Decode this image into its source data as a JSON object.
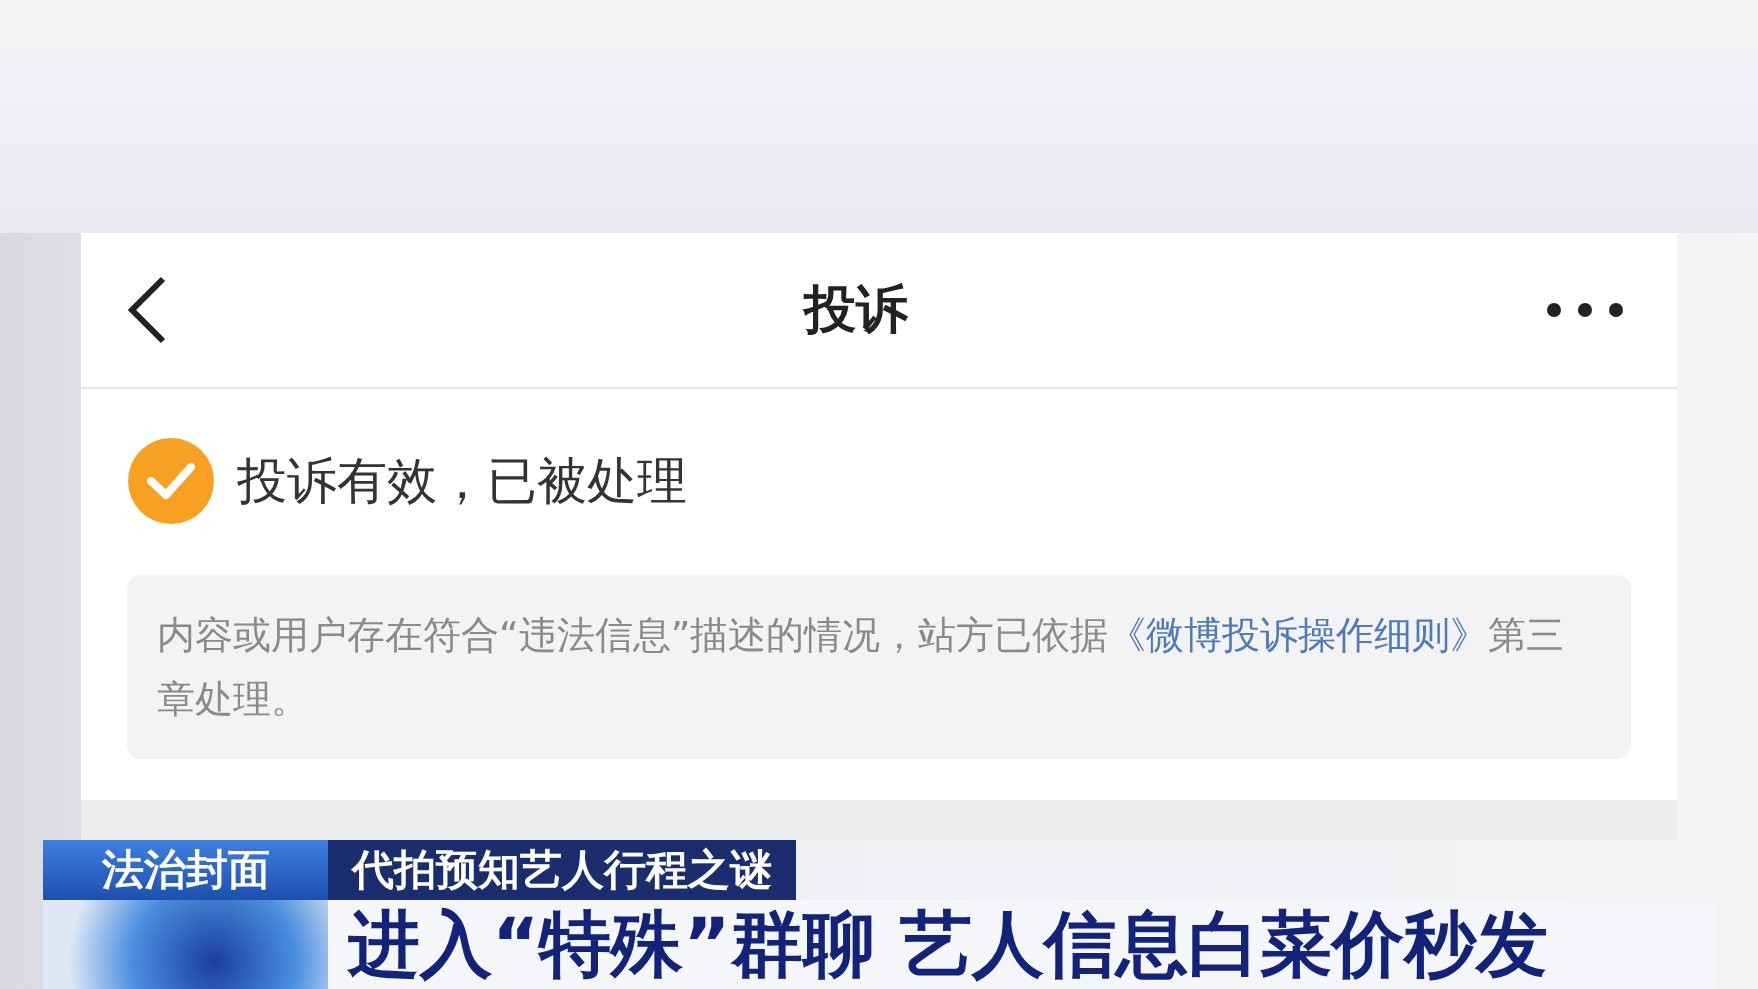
{
  "header": {
    "title": "投诉"
  },
  "status": {
    "text": "投诉有效，已被处理"
  },
  "notice": {
    "before": "内容或用户存在符合“违法信息”描述的情况，站方已依据",
    "link": "《微博投诉操作细则》",
    "after": "第三章处理。"
  },
  "caption": {
    "program": "法治封面",
    "topic": "代拍预知艺人行程之谜",
    "headline": "进入“特殊”群聊 艺人信息白菜价秒发"
  }
}
